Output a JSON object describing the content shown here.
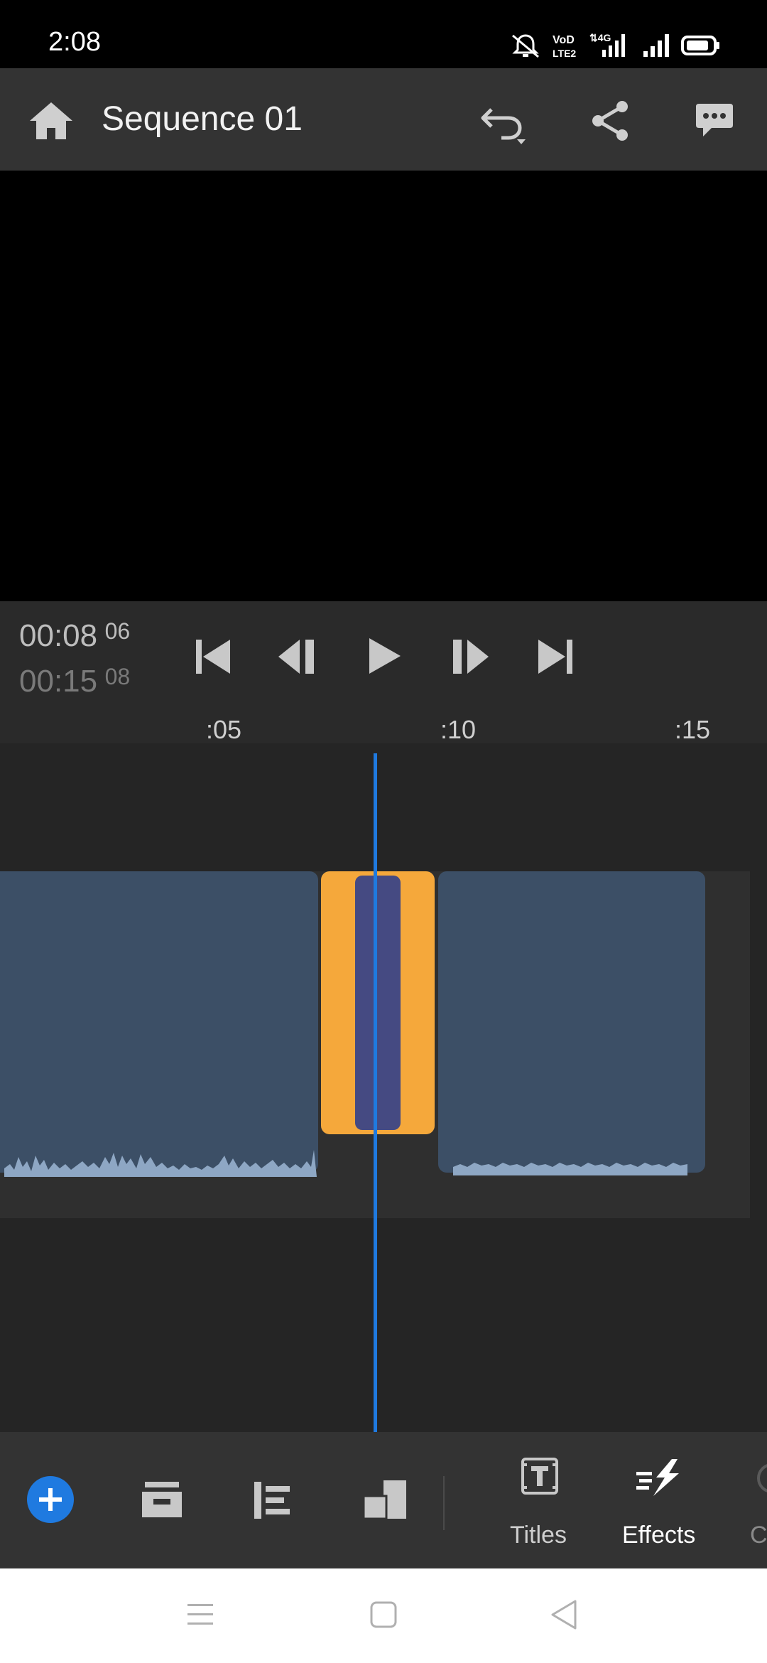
{
  "status_bar": {
    "time": "2:08",
    "icons": [
      "mute-alarm-icon",
      "volte-icon",
      "4g-signal-icon",
      "signal-icon",
      "battery-icon"
    ]
  },
  "header": {
    "title": "Sequence 01",
    "icons": [
      "home-icon",
      "undo-icon",
      "share-icon",
      "comment-icon"
    ]
  },
  "playback": {
    "current_time": "00:08",
    "current_frames": "06",
    "total_time": "00:15",
    "total_frames": "08"
  },
  "ruler": {
    "ticks": [
      ":05",
      ":10",
      ":15"
    ]
  },
  "toolbar": {
    "titles_label": "Titles",
    "effects_label": "Effects",
    "partial_label": "C"
  },
  "colors": {
    "accent": "#1f7ae0",
    "selected_clip": "#f5a83b",
    "clip": "#3c4f66",
    "waveform": "#8ea7c4",
    "inner_clip": "#454a82"
  }
}
